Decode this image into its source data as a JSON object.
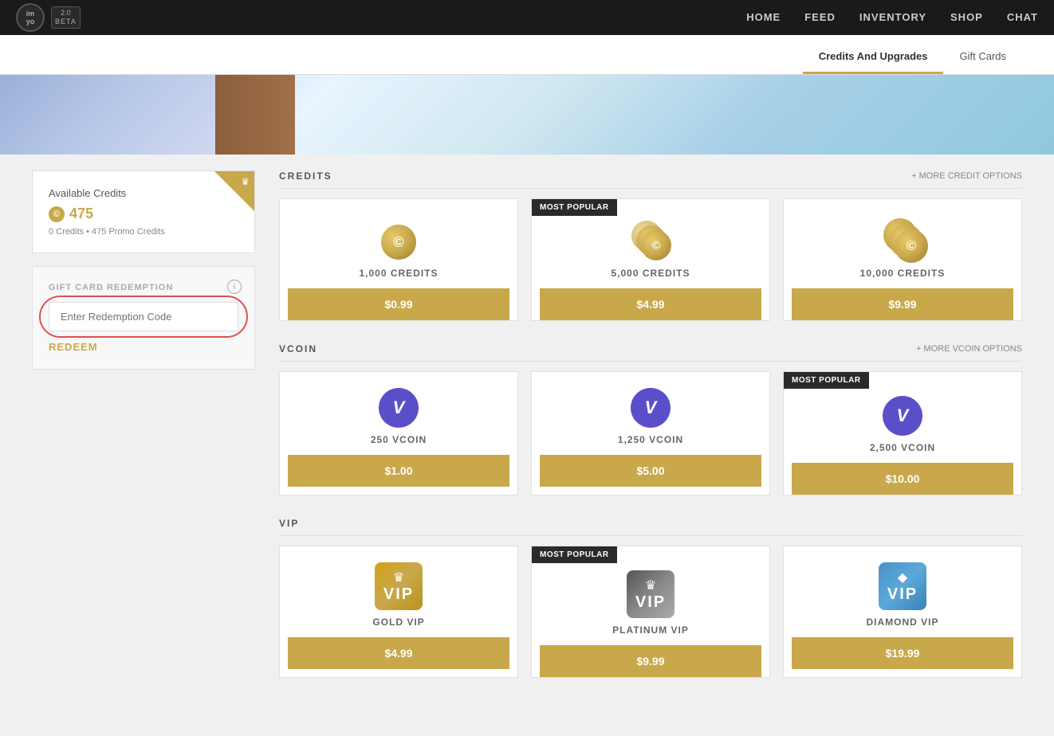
{
  "navbar": {
    "logo_text": "im\nyo",
    "beta_label": "2.0\nBETA",
    "nav_items": [
      {
        "label": "HOME",
        "href": "#"
      },
      {
        "label": "FEED",
        "href": "#"
      },
      {
        "label": "INVENTORY",
        "href": "#"
      },
      {
        "label": "SHOP",
        "href": "#"
      },
      {
        "label": "CHAT",
        "href": "#"
      }
    ]
  },
  "subnav": {
    "tabs": [
      {
        "label": "Credits And Upgrades",
        "active": true
      },
      {
        "label": "Gift Cards",
        "active": false
      }
    ]
  },
  "left_panel": {
    "credits_title": "Available Credits",
    "credits_amount": "475",
    "credits_detail": "0 Credits • 475 Promo Credits",
    "redemption_label": "GIFT CARD REDEMPTION",
    "redemption_placeholder": "Enter Redemption Code",
    "redeem_btn": "REDEEM"
  },
  "credits_section": {
    "title": "CREDITS",
    "more_label": "+ MORE CREDIT OPTIONS",
    "cards": [
      {
        "label": "1,000 CREDITS",
        "price": "$0.99",
        "popular": false
      },
      {
        "label": "5,000 CREDITS",
        "price": "$4.99",
        "popular": true
      },
      {
        "label": "10,000 CREDITS",
        "price": "$9.99",
        "popular": false
      }
    ]
  },
  "vcoin_section": {
    "title": "VCOIN",
    "more_label": "+ MORE VCOIN OPTIONS",
    "cards": [
      {
        "label": "250 VCOIN",
        "price": "$1.00",
        "popular": false
      },
      {
        "label": "1,250 VCOIN",
        "price": "$5.00",
        "popular": false
      },
      {
        "label": "2,500 VCOIN",
        "price": "$10.00",
        "popular": true
      }
    ]
  },
  "vip_section": {
    "title": "VIP",
    "more_label": "",
    "cards": [
      {
        "label": "GOLD VIP",
        "price": "$4.99",
        "popular": false,
        "type": "gold"
      },
      {
        "label": "PLATINUM VIP",
        "price": "$9.99",
        "popular": true,
        "type": "platinum"
      },
      {
        "label": "DIAMOND VIP",
        "price": "$19.99",
        "popular": false,
        "type": "diamond"
      }
    ]
  },
  "icons": {
    "coin": "©",
    "crown": "♛",
    "diamond": "◆",
    "info": "i"
  }
}
